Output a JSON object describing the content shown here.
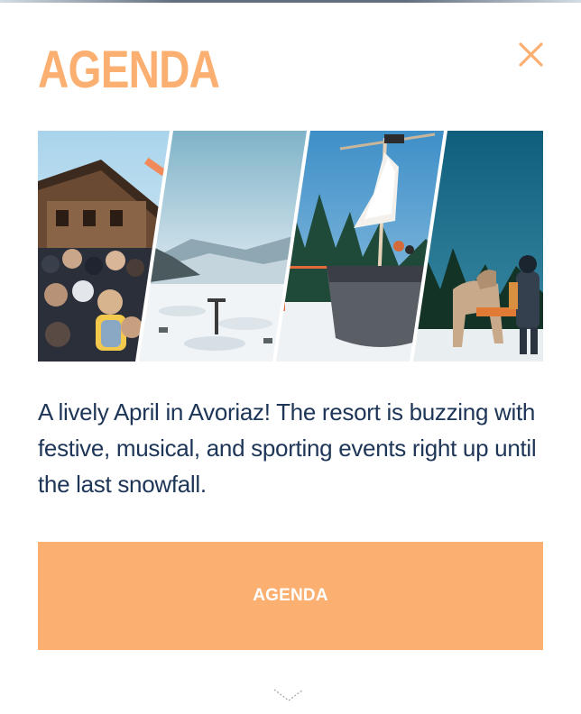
{
  "modal": {
    "title": "AGENDA",
    "description": "A lively April in Avoriaz! The resort is buzzing with festive, musical, and sporting events right up until the last snowfall.",
    "cta_label": "AGENDA",
    "close_icon": "close-icon",
    "scroll_icon": "chevron-down-icon"
  },
  "colors": {
    "accent": "#fbb071",
    "text": "#1d3557",
    "background": "#ffffff"
  }
}
